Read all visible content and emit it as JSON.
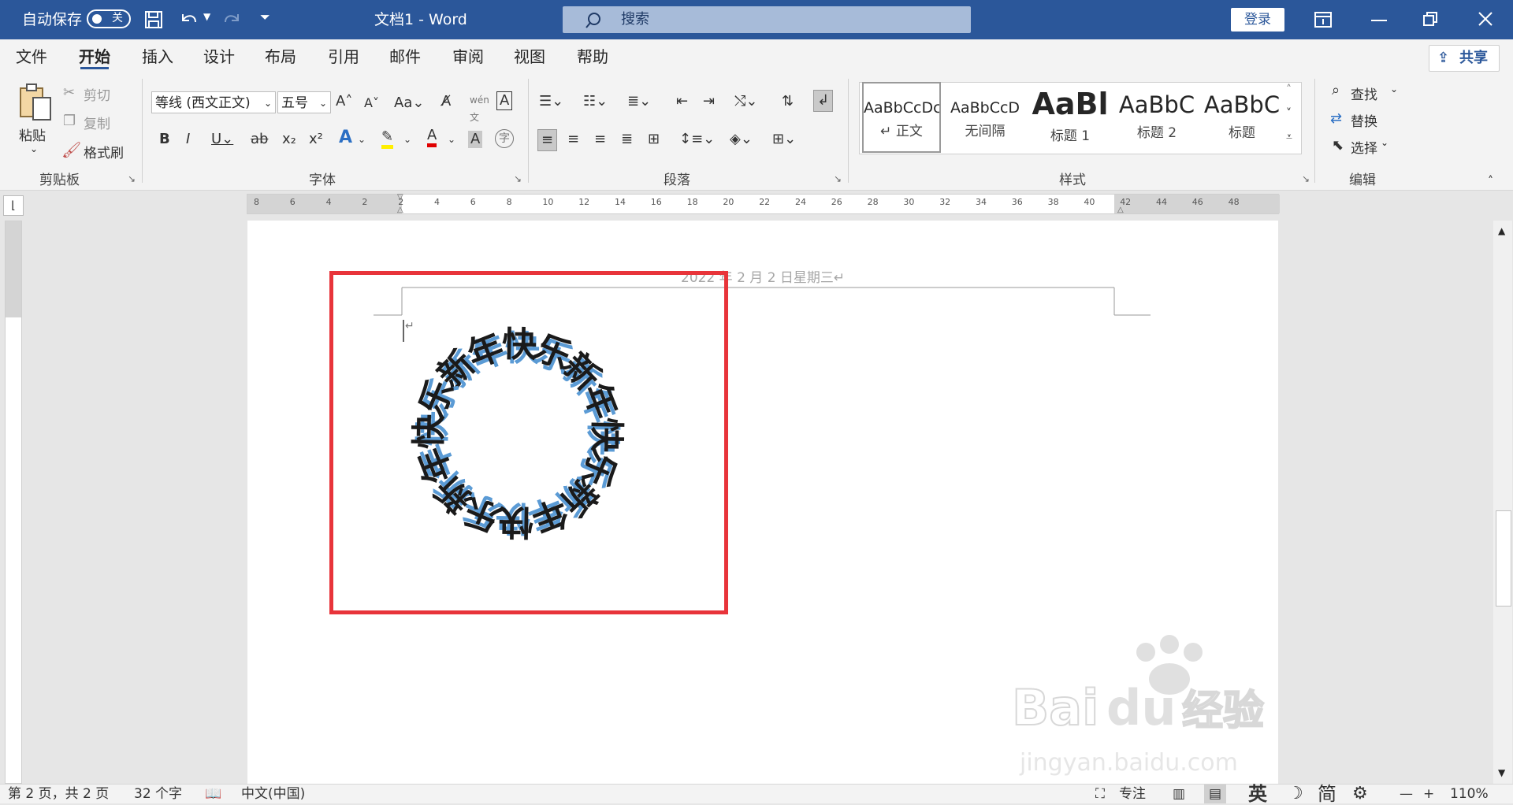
{
  "titlebar": {
    "autosave_label": "自动保存",
    "autosave_state": "关",
    "document_title": "文档1  -  Word",
    "search_placeholder": "搜索",
    "login_label": "登录"
  },
  "menu": {
    "tabs": [
      "文件",
      "开始",
      "插入",
      "设计",
      "布局",
      "引用",
      "邮件",
      "审阅",
      "视图",
      "帮助"
    ],
    "active_tab": "开始",
    "share_label": "共享"
  },
  "ribbon": {
    "clipboard": {
      "paste": "粘贴",
      "cut": "剪切",
      "copy": "复制",
      "format_painter": "格式刷",
      "group_label": "剪贴板"
    },
    "font": {
      "font_name": "等线 (西文正文)",
      "font_size": "五号",
      "group_label": "字体"
    },
    "paragraph": {
      "group_label": "段落"
    },
    "styles": {
      "items": [
        {
          "preview": "AaBbCcDc",
          "name": "↵ 正文"
        },
        {
          "preview": "AaBbCcD",
          "name": "无间隔"
        },
        {
          "preview": "AaBl",
          "name": "标题 1"
        },
        {
          "preview": "AaBbC",
          "name": "标题 2"
        },
        {
          "preview": "AaBbC",
          "name": "标题"
        }
      ],
      "group_label": "样式"
    },
    "editing": {
      "find": "查找",
      "replace": "替换",
      "select": "选择",
      "group_label": "编辑"
    }
  },
  "ruler": {
    "labels": [
      "8",
      "6",
      "4",
      "2",
      "2",
      "4",
      "6",
      "8",
      "10",
      "12",
      "14",
      "16",
      "18",
      "20",
      "22",
      "24",
      "26",
      "28",
      "30",
      "32",
      "34",
      "36",
      "38",
      "40",
      "42",
      "44",
      "46",
      "48"
    ]
  },
  "document": {
    "header_text": "2022 年 2 月 2 日星期三↵",
    "paragraph_mark": "↵",
    "circle_text": "新年快乐新年快乐新年快乐新年快乐"
  },
  "colors": {
    "accent": "#2b579a",
    "highlight_box": "#e8343a",
    "text_shadow": "#5b9bd5"
  },
  "statusbar": {
    "page_info": "第 2 页，共 2 页",
    "word_count": "32 个字",
    "language": "中文(中国)",
    "focus": "专注",
    "zoom": "110%"
  },
  "ime": {
    "lang": "英",
    "mode": "简"
  },
  "watermark": {
    "brand": "Bai du 经验",
    "url": "jingyan.baidu.com"
  }
}
